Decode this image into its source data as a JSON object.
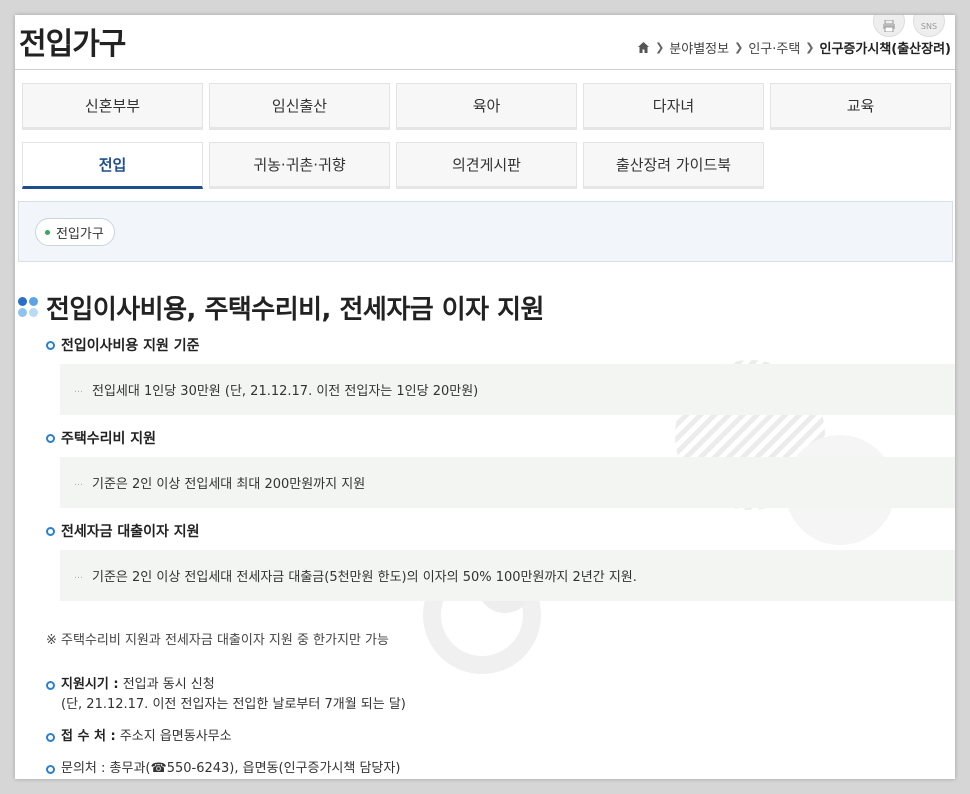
{
  "header": {
    "title": "전입가구",
    "util_print": "",
    "util_sns": "SNS"
  },
  "breadcrumb": {
    "items": [
      "분야별정보",
      "인구·주택"
    ],
    "current": "인구증가시책(출산장려)"
  },
  "tabs": {
    "row1": [
      "신혼부부",
      "임신출산",
      "육아",
      "다자녀",
      "교육"
    ],
    "row2": [
      "전입",
      "귀농·귀촌·귀향",
      "의견게시판",
      "출산장려 가이드북"
    ],
    "active": "전입"
  },
  "subnav": {
    "pill": "전입가구"
  },
  "section": {
    "heading": "전입이사비용, 주택수리비, 전세자금 이자 지원",
    "items": [
      {
        "title": "전입이사비용 지원 기준",
        "desc": "전입세대 1인당 30만원 (단, 21.12.17. 이전 전입자는 1인당 20만원)"
      },
      {
        "title": "주택수리비 지원",
        "desc": "기준은 2인 이상 전입세대 최대 200만원까지 지원"
      },
      {
        "title": "전세자금 대출이자 지원",
        "desc": "기준은 2인 이상 전입세대 전세자금 대출금(5천만원 한도)의 이자의 50% 100만원까지 2년간 지원."
      }
    ],
    "note": "※ 주택수리비 지원과 전세자금 대출이자 지원 중 한가지만 가능",
    "info": {
      "period_label": "지원시기 :",
      "period_value": "전입과 동시 신청",
      "period_sub": "(단, 21.12.17. 이전 전입자는 전입한 날로부터 7개월 되는 달)",
      "office_label": "접 수 처 :",
      "office_value": "주소지 읍면동사무소",
      "contact_label": "문의처 :",
      "contact_value": "총무과(☎550-6243), 읍면동(인구증가시책 담당자)"
    }
  },
  "colors": {
    "accent": "#1f4d8f",
    "ring": "#2a7fd1",
    "box_bg": "#f2f5f2",
    "subnav_bg": "#f2f6fa"
  }
}
